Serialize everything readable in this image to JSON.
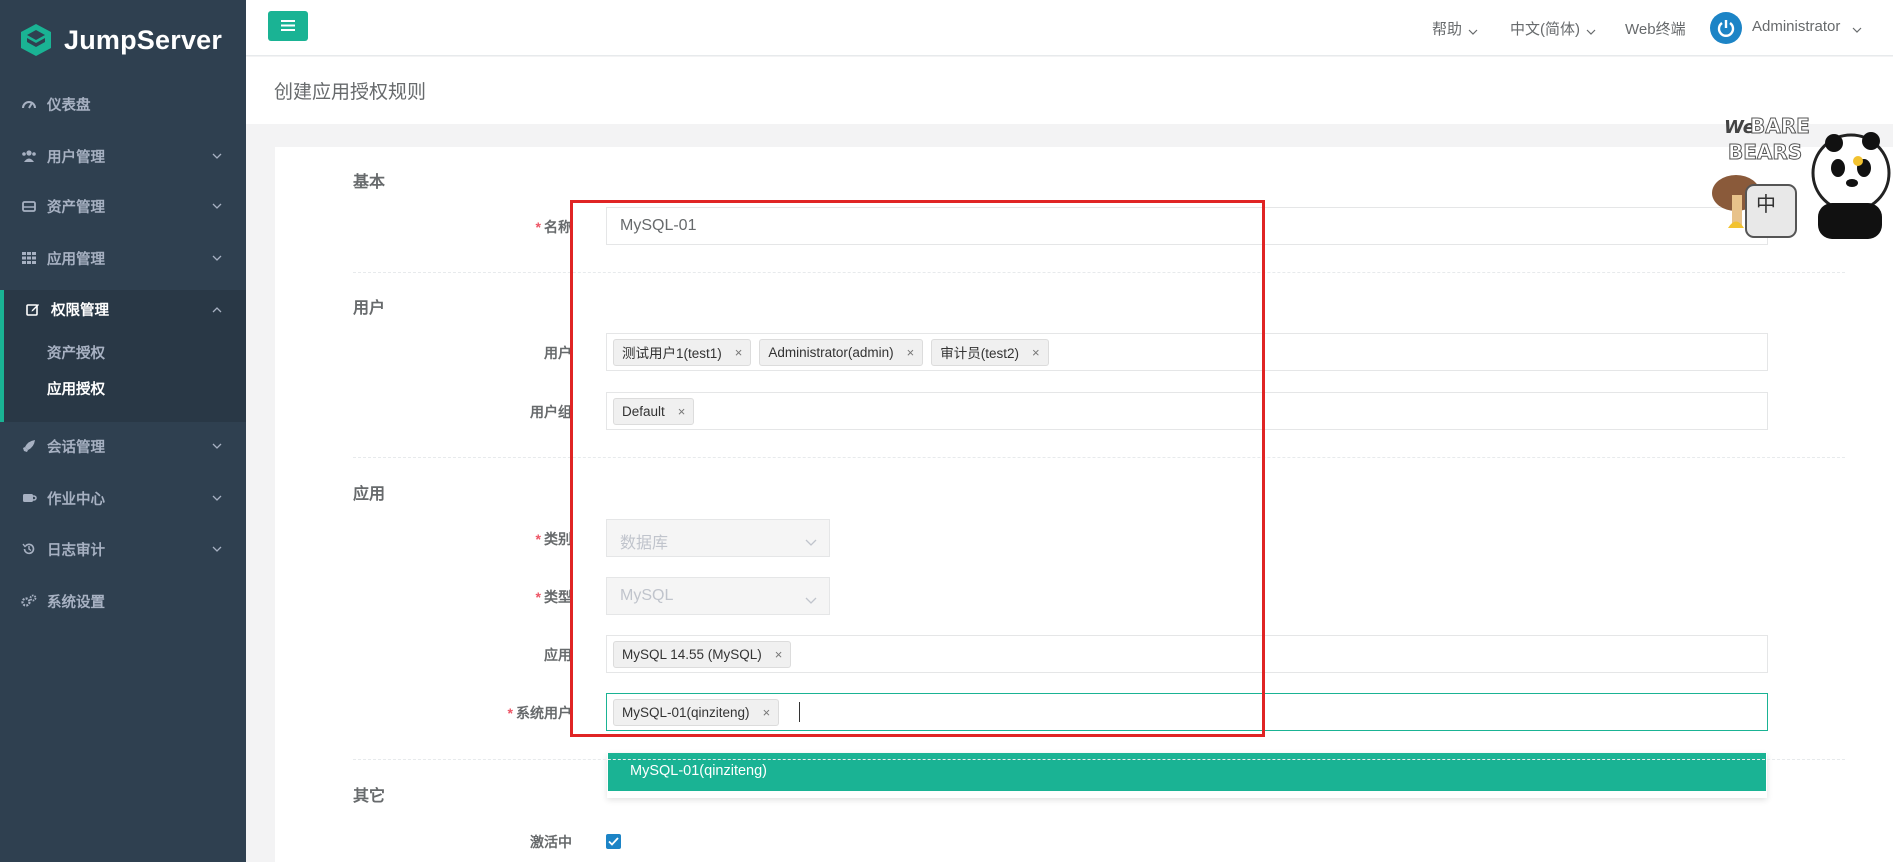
{
  "app": {
    "brand": "JumpServer"
  },
  "sidebar": {
    "items": [
      {
        "label": "仪表盘",
        "icon": "dashboard-icon"
      },
      {
        "label": "用户管理",
        "icon": "users-icon"
      },
      {
        "label": "资产管理",
        "icon": "inbox-icon"
      },
      {
        "label": "应用管理",
        "icon": "grid-icon"
      },
      {
        "label": "权限管理",
        "icon": "edit-icon",
        "active": true
      },
      {
        "label": "会话管理",
        "icon": "rocket-icon"
      },
      {
        "label": "作业中心",
        "icon": "coffee-icon"
      },
      {
        "label": "日志审计",
        "icon": "history-icon"
      },
      {
        "label": "系统设置",
        "icon": "gears-icon"
      }
    ],
    "sub_items": [
      {
        "label": "资产授权"
      },
      {
        "label": "应用授权",
        "current": true
      }
    ]
  },
  "topbar": {
    "help": "帮助",
    "language": "中文(简体)",
    "web_terminal": "Web终端",
    "user": "Administrator"
  },
  "page": {
    "title": "创建应用授权规则"
  },
  "sections": {
    "basic": "基本",
    "user": "用户",
    "app": "应用",
    "other": "其它"
  },
  "form": {
    "name": {
      "label": "名称",
      "value": "MySQL-01"
    },
    "users": {
      "label": "用户",
      "tags": [
        "测试用户1(test1)",
        "Administrator(admin)",
        "审计员(test2)"
      ]
    },
    "user_groups": {
      "label": "用户组",
      "tags": [
        "Default"
      ]
    },
    "category": {
      "label": "类别",
      "value": "数据库"
    },
    "type": {
      "label": "类型",
      "value": "MySQL"
    },
    "applications": {
      "label": "应用",
      "tags": [
        "MySQL 14.55 (MySQL)"
      ]
    },
    "system_users": {
      "label": "系统用户",
      "tags": [
        "MySQL-01(qinziteng)"
      ],
      "dropdown_option": "MySQL-01(qinziteng)"
    },
    "active": {
      "label": "激活中",
      "checked": true
    }
  },
  "sticker": {
    "text": "We BARE BEARS",
    "cn": "中"
  },
  "colors": {
    "accent": "#1ab394",
    "sidebar": "#2f4050",
    "highlight_box": "#e02424",
    "required": "#ed5565"
  }
}
